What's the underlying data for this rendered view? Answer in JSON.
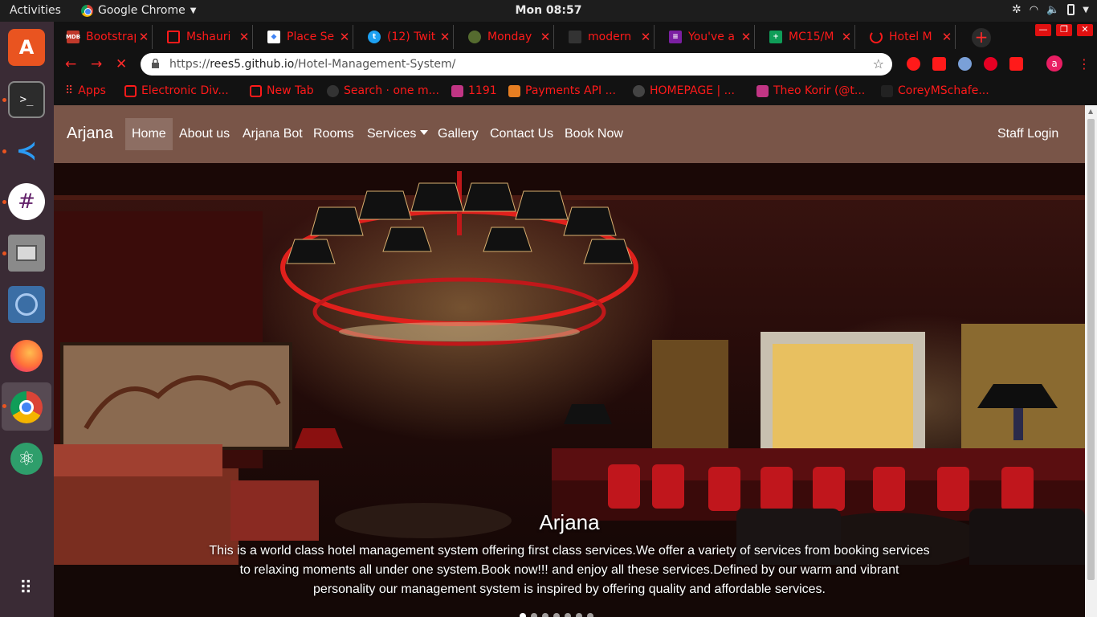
{
  "topbar": {
    "activities": "Activities",
    "app_name": "Google Chrome",
    "clock": "Mon 08:57"
  },
  "tabs": [
    {
      "title": "Bootstrap",
      "fav": "MDB",
      "color": "#c0392b"
    },
    {
      "title": "Mshauri",
      "fav": "",
      "color": "#ff1a1a"
    },
    {
      "title": "Place Se",
      "fav": "",
      "color": "#4285f4"
    },
    {
      "title": "(12) Twit",
      "fav": "",
      "color": "#1da1f2"
    },
    {
      "title": "Monday",
      "fav": "",
      "color": "#556b2f"
    },
    {
      "title": "modern",
      "fav": "",
      "color": "#333333"
    },
    {
      "title": "You've a",
      "fav": "",
      "color": "#7b1fa2"
    },
    {
      "title": "MC15/M",
      "fav": "",
      "color": "#0f9d58"
    },
    {
      "title": "Hotel M",
      "fav": "",
      "color": "#ff1a1a"
    }
  ],
  "toolbar": {
    "url_scheme": "https://",
    "url_host": "rees5.github.io",
    "url_path": "/Hotel-Management-System/"
  },
  "bookmarks": [
    {
      "label": "Apps",
      "color": "#e53935"
    },
    {
      "label": "Electronic Div...",
      "color": "#ff1a1a"
    },
    {
      "label": "New Tab",
      "color": "#ff1a1a"
    },
    {
      "label": "Search · one m...",
      "color": "#333333"
    },
    {
      "label": "1191",
      "color": "#c13584"
    },
    {
      "label": "Payments API ...",
      "color": "#e67e22"
    },
    {
      "label": "HOMEPAGE | ...",
      "color": "#444444"
    },
    {
      "label": "Theo Korir (@t...",
      "color": "#c13584"
    },
    {
      "label": "CoreyMSchafe...",
      "color": "#222222"
    }
  ],
  "navbar": {
    "brand": "Arjana",
    "links": [
      "Home",
      "About us",
      "Arjana Bot",
      "Rooms",
      "Services",
      "Gallery",
      "Contact Us",
      "Book Now"
    ],
    "staff_login": "Staff Login"
  },
  "hero": {
    "title": "Arjana",
    "text": "This is a world class hotel management system offering first class services.We offer a variety of services from booking services to relaxing moments all under one system.Book now!!! and enjoy all these services.Defined by our warm and vibrant personality our management system is inspired by offering quality and affordable services."
  },
  "colors": {
    "navbar": "#795548",
    "tab_text": "#ff1a1a",
    "dock": "#3a2b35"
  }
}
